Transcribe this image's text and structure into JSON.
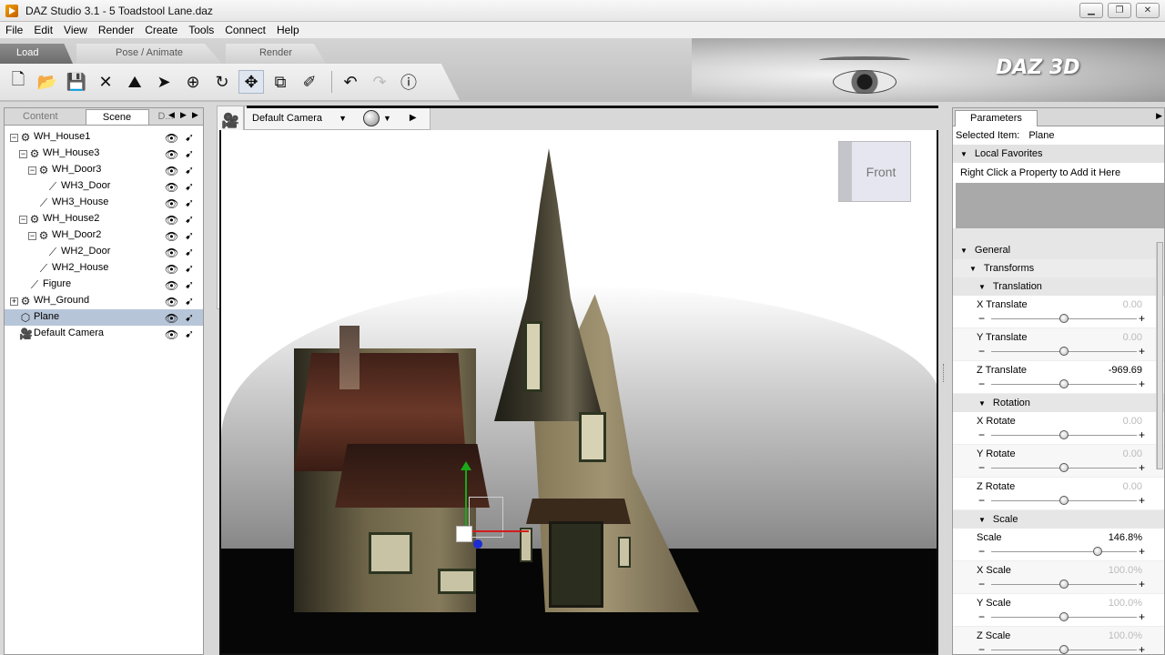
{
  "window": {
    "title": "DAZ Studio 3.1 - 5 Toadstool Lane.daz",
    "min_glyph": "▁",
    "max_glyph": "❐",
    "close_glyph": "✕"
  },
  "menu": [
    "File",
    "Edit",
    "View",
    "Render",
    "Create",
    "Tools",
    "Connect",
    "Help"
  ],
  "brand": "DAZ 3D",
  "top_tabs": {
    "load": "Load",
    "pose": "Pose / Animate",
    "render": "Render"
  },
  "toolbar_icons": [
    "new-file-icon",
    "open-folder-icon",
    "save-icon",
    "delete-icon",
    "scene-icon",
    "select-arrow-icon",
    "rotate-icon",
    "refresh-icon",
    "move-icon",
    "scale-icon",
    "universal-tool-icon",
    "undo-icon",
    "redo-icon",
    "help-icon"
  ],
  "left_panel": {
    "tabs": {
      "content": "Content",
      "scene": "Scene",
      "third": "D..."
    },
    "nav_left": "◀",
    "nav_right": "▶",
    "nav_more": "▶",
    "tree": [
      {
        "label": "WH_House1",
        "level": 0,
        "type": "group",
        "expander": "−"
      },
      {
        "label": "WH_House3",
        "level": 1,
        "type": "group",
        "expander": "−"
      },
      {
        "label": "WH_Door3",
        "level": 2,
        "type": "group",
        "expander": "−"
      },
      {
        "label": "WH3_Door",
        "level": 3,
        "type": "bone",
        "expander": ""
      },
      {
        "label": "WH3_House",
        "level": 2,
        "type": "bone",
        "expander": ""
      },
      {
        "label": "WH_House2",
        "level": 1,
        "type": "group",
        "expander": "−"
      },
      {
        "label": "WH_Door2",
        "level": 2,
        "type": "group",
        "expander": "−"
      },
      {
        "label": "WH2_Door",
        "level": 3,
        "type": "bone",
        "expander": ""
      },
      {
        "label": "WH2_House",
        "level": 2,
        "type": "bone",
        "expander": ""
      },
      {
        "label": "Figure",
        "level": 1,
        "type": "bone",
        "expander": ""
      },
      {
        "label": "WH_Ground",
        "level": 0,
        "type": "group",
        "expander": "+"
      },
      {
        "label": "Plane",
        "level": 0,
        "type": "prop",
        "expander": "",
        "selected": true
      },
      {
        "label": "Default Camera",
        "level": 0,
        "type": "camera",
        "expander": ""
      }
    ]
  },
  "viewport": {
    "camera": "Default Camera",
    "cube_label": "Front",
    "play_glyph": "▶"
  },
  "parameters": {
    "tab": "Parameters",
    "selected_label": "Selected Item:",
    "selected_value": "Plane",
    "local_favorites": "Local Favorites",
    "fav_hint": "Right Click a Property to Add it Here",
    "general": "General",
    "transforms": "Transforms",
    "translation": "Translation",
    "rotation": "Rotation",
    "scale_group": "Scale",
    "params": [
      {
        "label": "X Translate",
        "value": "0.00",
        "set": false,
        "level": 0.5
      },
      {
        "label": "Y Translate",
        "value": "0.00",
        "set": false,
        "level": 0.5
      },
      {
        "label": "Z Translate",
        "value": "-969.69",
        "set": true,
        "level": 0.5
      },
      {
        "label": "X Rotate",
        "value": "0.00",
        "set": false,
        "level": 0.5
      },
      {
        "label": "Y Rotate",
        "value": "0.00",
        "set": false,
        "level": 0.5
      },
      {
        "label": "Z Rotate",
        "value": "0.00",
        "set": false,
        "level": 0.5
      },
      {
        "label": "Scale",
        "value": "146.8%",
        "set": true,
        "level": 0.73
      },
      {
        "label": "X Scale",
        "value": "100.0%",
        "set": false,
        "level": 0.5
      },
      {
        "label": "Y Scale",
        "value": "100.0%",
        "set": false,
        "level": 0.5
      },
      {
        "label": "Z Scale",
        "value": "100.0%",
        "set": false,
        "level": 0.5
      }
    ]
  },
  "glyphs": {
    "minus": "−",
    "plus": "+",
    "collapse": "▼",
    "dropdown": "▼"
  }
}
